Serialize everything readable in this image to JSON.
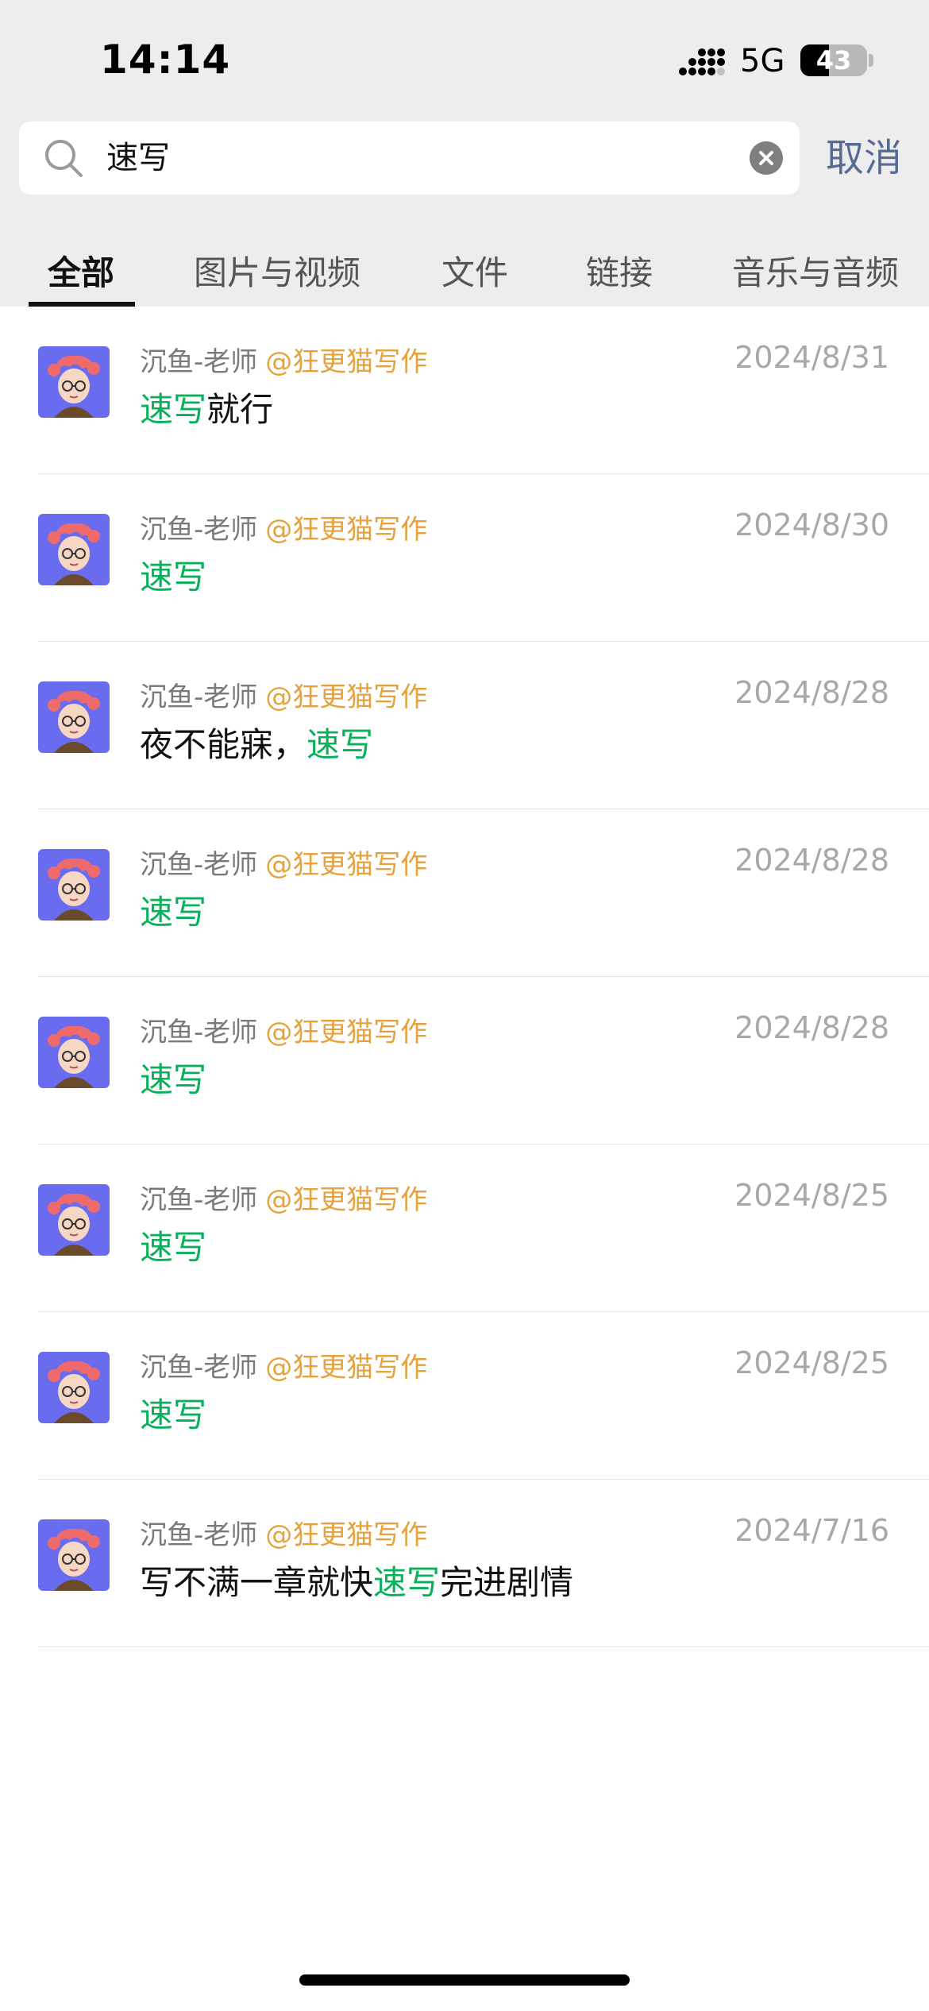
{
  "status_bar": {
    "time": "14:14",
    "network": "5G",
    "battery_level": "43",
    "battery_fraction": 0.43
  },
  "search": {
    "query": "速写",
    "cancel_label": "取消"
  },
  "tabs": [
    {
      "label": "全部",
      "active": true
    },
    {
      "label": "图片与视频",
      "active": false
    },
    {
      "label": "文件",
      "active": false
    },
    {
      "label": "链接",
      "active": false
    },
    {
      "label": "音乐与音频",
      "active": false
    }
  ],
  "results": [
    {
      "sender": "沉鱼-老师",
      "group": "@狂更猫写作",
      "date": "2024/8/31",
      "text_before": "",
      "keyword": "速写",
      "text_after": "就行"
    },
    {
      "sender": "沉鱼-老师",
      "group": "@狂更猫写作",
      "date": "2024/8/30",
      "text_before": "",
      "keyword": "速写",
      "text_after": ""
    },
    {
      "sender": "沉鱼-老师",
      "group": "@狂更猫写作",
      "date": "2024/8/28",
      "text_before": "夜不能寐，",
      "keyword": "速写",
      "text_after": ""
    },
    {
      "sender": "沉鱼-老师",
      "group": "@狂更猫写作",
      "date": "2024/8/28",
      "text_before": "",
      "keyword": "速写",
      "text_after": ""
    },
    {
      "sender": "沉鱼-老师",
      "group": "@狂更猫写作",
      "date": "2024/8/28",
      "text_before": "",
      "keyword": "速写",
      "text_after": ""
    },
    {
      "sender": "沉鱼-老师",
      "group": "@狂更猫写作",
      "date": "2024/8/25",
      "text_before": "",
      "keyword": "速写",
      "text_after": ""
    },
    {
      "sender": "沉鱼-老师",
      "group": "@狂更猫写作",
      "date": "2024/8/25",
      "text_before": "",
      "keyword": "速写",
      "text_after": ""
    },
    {
      "sender": "沉鱼-老师",
      "group": "@狂更猫写作",
      "date": "2024/7/16",
      "text_before": "写不满一章就快",
      "keyword": "速写",
      "text_after": "完进剧情"
    }
  ],
  "colors": {
    "highlight": "#07b15a",
    "group_mention": "#e6a23c",
    "cancel": "#576b95",
    "avatar_bg": "#6a6cf0"
  },
  "icons": {
    "search": "search-icon",
    "clear": "clear-icon",
    "signal": "signal-icon",
    "battery": "battery-icon",
    "avatar": "avatar"
  }
}
